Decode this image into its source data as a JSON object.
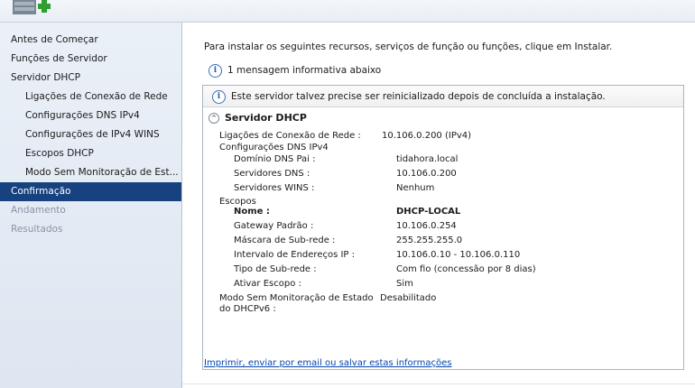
{
  "sidebar": {
    "items": [
      {
        "label": "Antes de Começar",
        "level": 0,
        "state": "normal"
      },
      {
        "label": "Funções de Servidor",
        "level": 0,
        "state": "normal"
      },
      {
        "label": "Servidor DHCP",
        "level": 0,
        "state": "normal"
      },
      {
        "label": "Ligações de Conexão de Rede",
        "level": 1,
        "state": "normal"
      },
      {
        "label": "Configurações DNS IPv4",
        "level": 1,
        "state": "normal"
      },
      {
        "label": "Configurações de IPv4 WINS",
        "level": 1,
        "state": "normal"
      },
      {
        "label": "Escopos DHCP",
        "level": 1,
        "state": "normal"
      },
      {
        "label": "Modo Sem Monitoração de Est...",
        "level": 1,
        "state": "normal"
      },
      {
        "label": "Confirmação",
        "level": 0,
        "state": "active"
      },
      {
        "label": "Andamento",
        "level": 0,
        "state": "disabled"
      },
      {
        "label": "Resultados",
        "level": 0,
        "state": "disabled"
      }
    ]
  },
  "main": {
    "intro": "Para instalar os seguintes recursos, serviços de função ou funções, clique em Instalar.",
    "info_message": "1 mensagem informativa abaixo",
    "info_icon": "info-icon",
    "details_header": "Este servidor talvez precise ser reinicializado depois de concluída a instalação.",
    "section_title": "Servidor DHCP",
    "section_toggle_icon": "collapse-icon",
    "link": "Imprimir, enviar por email ou salvar estas informações"
  },
  "details": {
    "network_bindings_label": "Ligações de Conexão de Rede :",
    "network_bindings_value": "10.106.0.200 (IPv4)",
    "dns_group": "Configurações DNS IPv4",
    "parent_domain_label": "Domínio DNS Pai :",
    "parent_domain_value": "tidahora.local",
    "dns_servers_label": "Servidores DNS :",
    "dns_servers_value": "10.106.0.200",
    "wins_servers_label": "Servidores WINS :",
    "wins_servers_value": "Nenhum",
    "scopes_group": "Escopos",
    "name_label": "Nome :",
    "name_value": "DHCP-LOCAL",
    "gateway_label": "Gateway Padrão :",
    "gateway_value": "10.106.0.254",
    "mask_label": "Máscara de Sub-rede :",
    "mask_value": "255.255.255.0",
    "range_label": "Intervalo de Endereços IP :",
    "range_value": "10.106.0.10 - 10.106.0.110",
    "subnet_type_label": "Tipo de Sub-rede :",
    "subnet_type_value": "Com fio (concessão por 8 dias)",
    "activate_label": "Ativar Escopo :",
    "activate_value": "Sim",
    "stateless_label_1": "Modo Sem Monitoração de Estado",
    "stateless_label_2": "do DHCPv6 :",
    "stateless_value": "Desabilitado"
  },
  "colors": {
    "active_nav": "#17427f",
    "link": "#0645ad",
    "sidebar_bg": "#e4ebf4"
  }
}
